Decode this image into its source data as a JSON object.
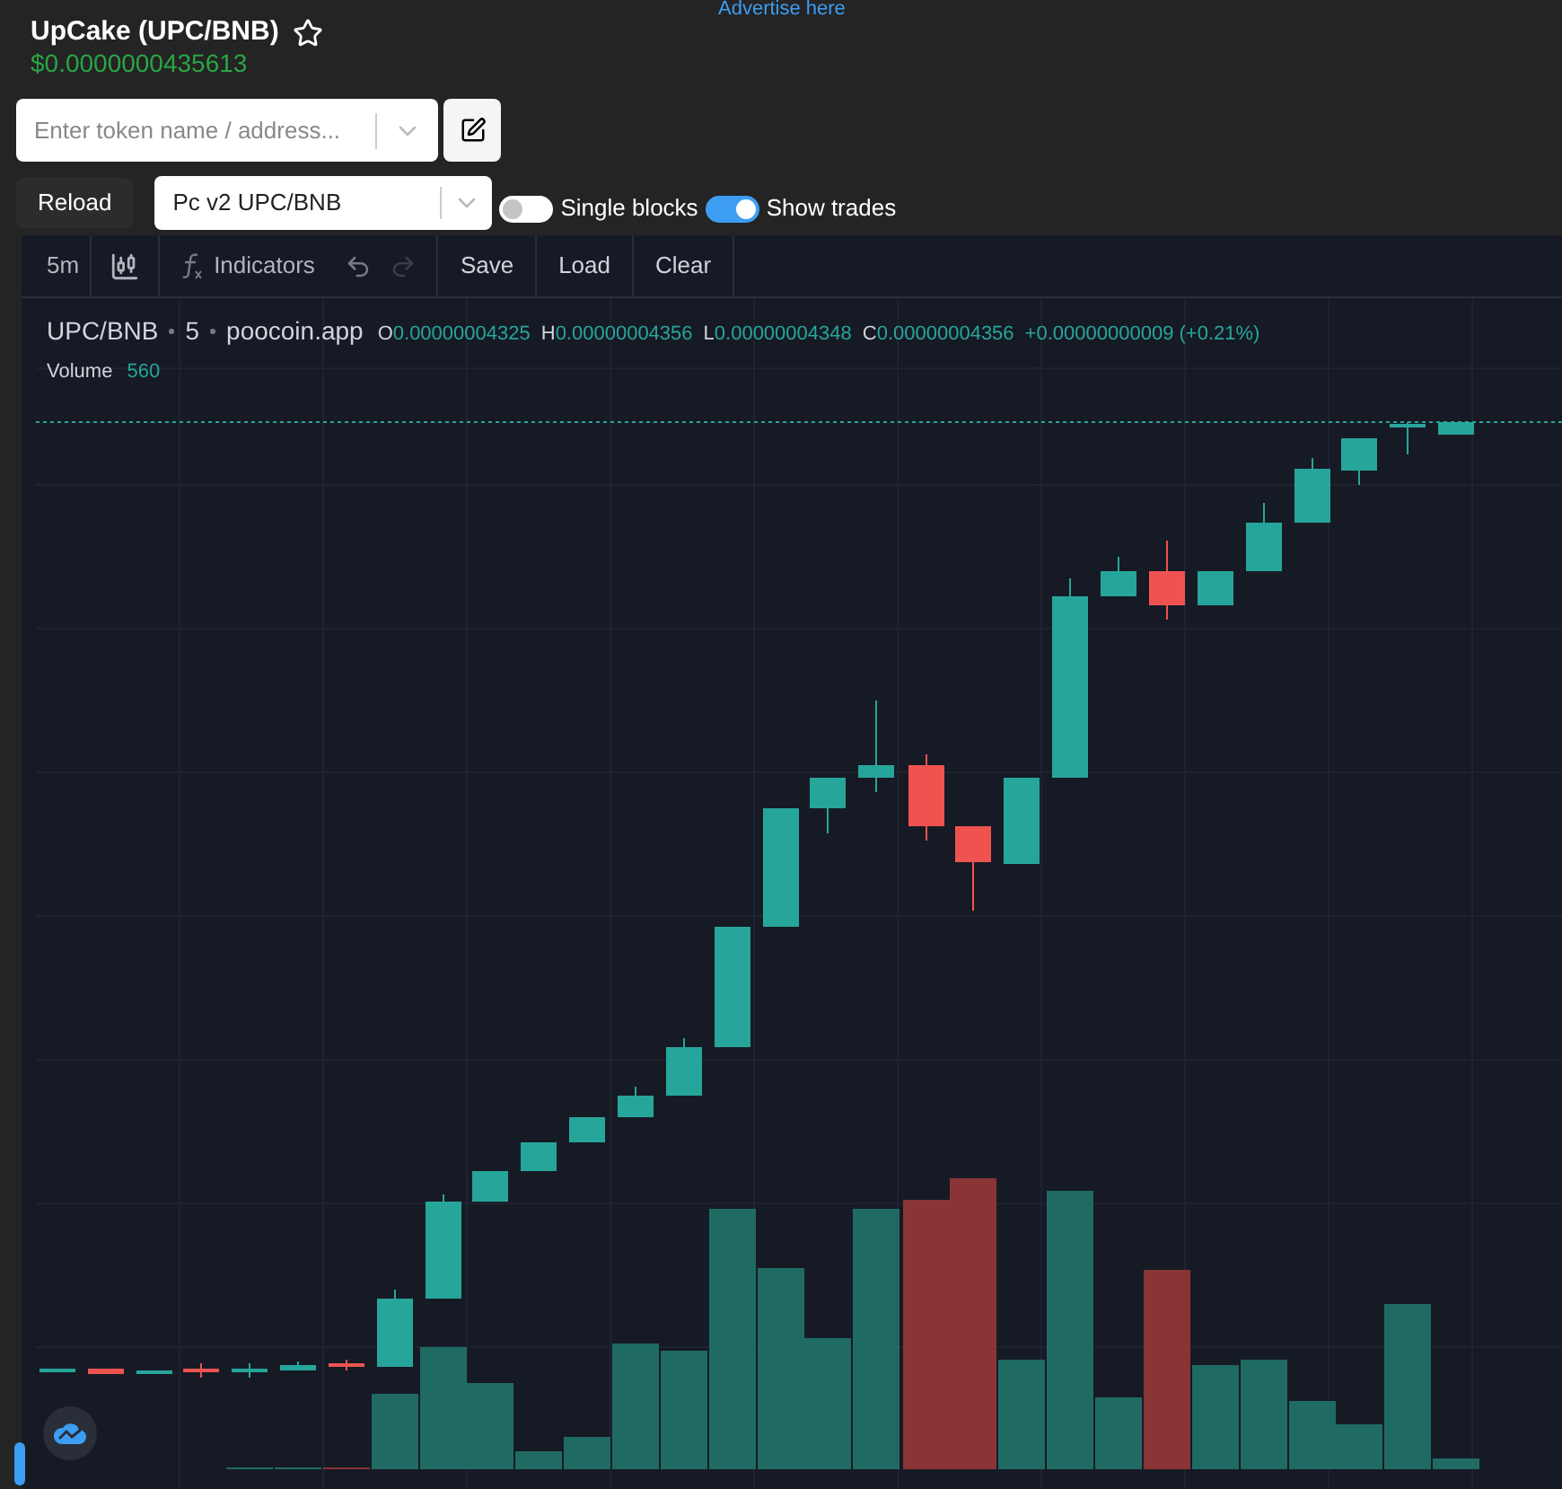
{
  "advertise": "Advertise here",
  "token": {
    "title": "UpCake (UPC/BNB)",
    "price": "$0.0000000435613"
  },
  "search": {
    "placeholder": "Enter token name / address..."
  },
  "reload": "Reload",
  "pair_select": {
    "value": "Pc v2 UPC/BNB"
  },
  "toggles": [
    {
      "label": "Single blocks",
      "on": false
    },
    {
      "label": "Show trades",
      "on": true
    }
  ],
  "toolbar": {
    "interval": "5m",
    "indicators": "Indicators",
    "history": [
      {
        "kind": "undo",
        "disabled": false
      },
      {
        "kind": "redo",
        "disabled": true
      }
    ],
    "buttons": [
      "Save",
      "Load",
      "Clear"
    ]
  },
  "legend": {
    "symbol": "UPC/BNB",
    "interval": "5",
    "source": "poocoin.app",
    "ohlc": [
      {
        "label": "O",
        "value": "0.00000004325"
      },
      {
        "label": "H",
        "value": "0.00000004356"
      },
      {
        "label": "L",
        "value": "0.00000004348"
      },
      {
        "label": "C",
        "value": "0.00000004356"
      }
    ],
    "change": "+0.00000000009 (+0.21%)",
    "volume_label": "Volume",
    "volume_value": "560"
  }
}
